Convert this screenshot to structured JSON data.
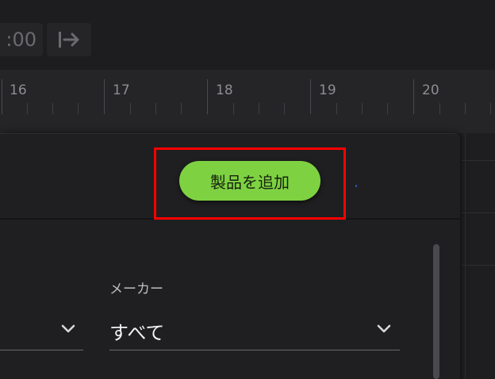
{
  "toolbar": {
    "time_fragment": ":00",
    "jump_icon": "jump-to-end-icon"
  },
  "timeline": {
    "labels": [
      "16",
      "17",
      "18",
      "19",
      "20"
    ]
  },
  "panel": {
    "add_product_label": "製品を追加",
    "fields": [
      {
        "label": "",
        "value": ""
      },
      {
        "label": "メーカー",
        "value": "すべて"
      }
    ]
  },
  "colors": {
    "accent": "#7ed242",
    "highlight": "#ff0000",
    "background": "#1c1c1e"
  }
}
